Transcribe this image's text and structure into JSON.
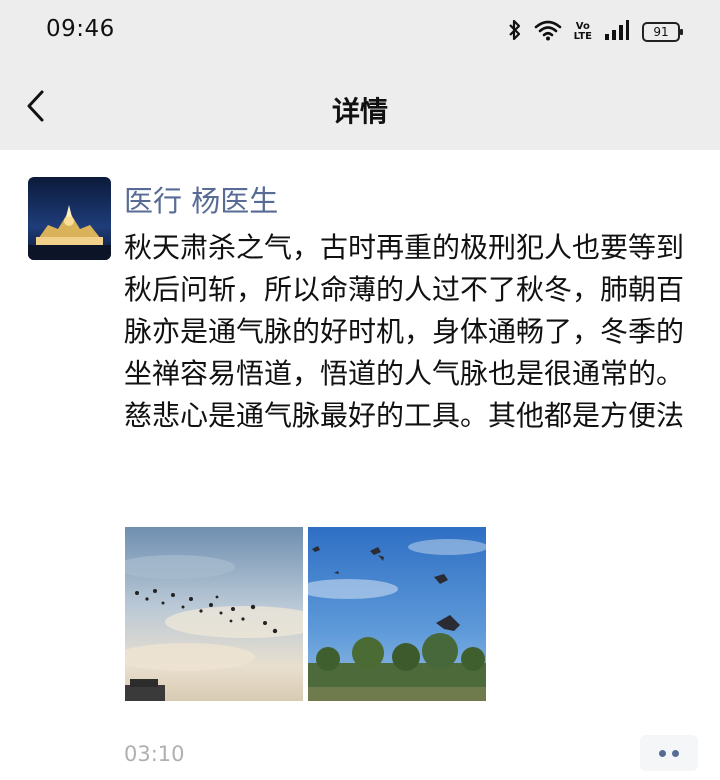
{
  "status_bar": {
    "time": "09:46",
    "icons": [
      "bluetooth-icon",
      "wifi-icon",
      "volte-icon",
      "signal-icon",
      "battery-icon"
    ],
    "volte_top": "Vo",
    "volte_bottom": "LTE",
    "battery_level": "91"
  },
  "nav": {
    "back_icon": "chevron-left-icon",
    "title": "详情"
  },
  "post": {
    "author": "医行 杨医生",
    "text": "秋天肃杀之气，古时再重的极刑犯人也要等到秋后问斩，所以命薄的人过不了秋冬，肺朝百脉亦是通气脉的好时机，身体通畅了，冬季的坐禅容易悟道，悟道的人气脉也是很通常的。\n慈悲心是通气脉最好的工具。其他都是方便法",
    "time": "03:10",
    "more_icon": "more-dots-icon"
  },
  "colors": {
    "header_bg": "#ededed",
    "link_blue": "#576b95",
    "timestamp_gray": "#b0b0b0"
  }
}
